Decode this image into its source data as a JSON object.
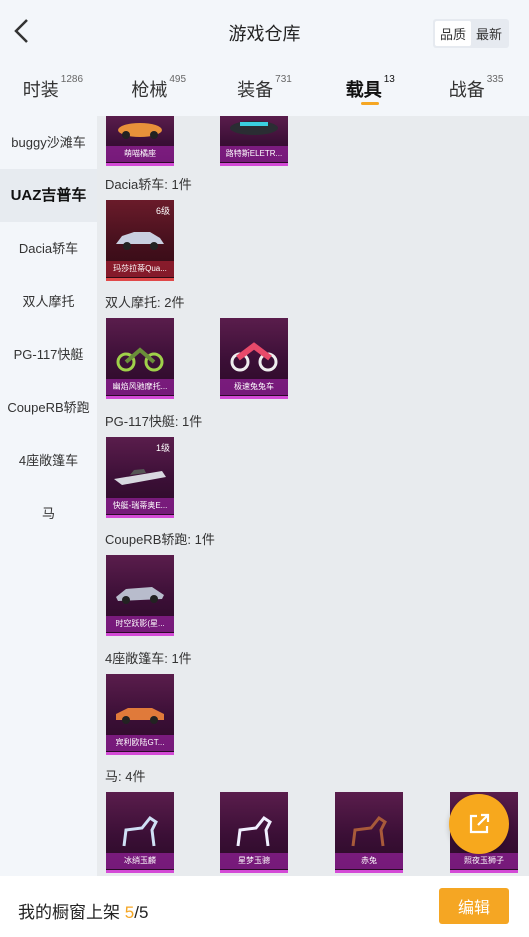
{
  "header": {
    "title": "游戏仓库",
    "sort_options": [
      "品质",
      "最新"
    ],
    "sort_active": 0
  },
  "tabs": [
    {
      "label": "时装",
      "count": "1286"
    },
    {
      "label": "枪械",
      "count": "495"
    },
    {
      "label": "装备",
      "count": "731"
    },
    {
      "label": "载具",
      "count": "13"
    },
    {
      "label": "战备",
      "count": "335"
    }
  ],
  "active_tab": 3,
  "sidebar": {
    "items": [
      "buggy沙滩车",
      "UAZ吉普车",
      "Dacia轿车",
      "双人摩托",
      "PG-117快艇",
      "CoupeRB轿跑",
      "4座敞篷车",
      "马"
    ],
    "active": 1
  },
  "partial_cards": [
    "萌喵橘座",
    "路特斯ELETR..."
  ],
  "sections": [
    {
      "label": "Dacia轿车: 1件",
      "items": [
        {
          "name": "玛莎拉蒂Qua...",
          "level": "6级",
          "rarity": "red",
          "icon": "sedan-icon"
        }
      ]
    },
    {
      "label": "双人摩托: 2件",
      "items": [
        {
          "name": "幽焰风驰摩托...",
          "level": "",
          "rarity": "purple",
          "icon": "motorbike-icon"
        },
        {
          "name": "极速兔兔车",
          "level": "",
          "rarity": "purple",
          "icon": "motorbike-icon"
        }
      ]
    },
    {
      "label": "PG-117快艇: 1件",
      "items": [
        {
          "name": "快艇-瑞蒂奥E...",
          "level": "1级",
          "rarity": "purple",
          "icon": "speedboat-icon"
        }
      ]
    },
    {
      "label": "CoupeRB轿跑: 1件",
      "items": [
        {
          "name": "时空跃影(星...",
          "level": "",
          "rarity": "purple",
          "icon": "sports-car-icon"
        }
      ]
    },
    {
      "label": "4座敞篷车: 1件",
      "items": [
        {
          "name": "宾利欧陆GT...",
          "level": "",
          "rarity": "purple",
          "icon": "convertible-icon"
        }
      ]
    },
    {
      "label": "马: 4件",
      "items": [
        {
          "name": "冰绡玉麟",
          "level": "",
          "rarity": "purple",
          "icon": "horse-icon"
        },
        {
          "name": "星梦玉骢",
          "level": "",
          "rarity": "purple",
          "icon": "horse-icon"
        },
        {
          "name": "赤兔",
          "level": "",
          "rarity": "purple",
          "icon": "horse-icon"
        },
        {
          "name": "照夜玉狮子",
          "level": "",
          "rarity": "purple",
          "icon": "horse-icon"
        }
      ]
    }
  ],
  "bottom": {
    "showcase_label": "我的橱窗上架 ",
    "current": "5",
    "separator": "/",
    "total": "5",
    "edit_label": "编辑"
  },
  "colors": {
    "accent": "#f5a623",
    "card_purple": "#5a1d4c",
    "card_red": "#6a1b2a"
  }
}
